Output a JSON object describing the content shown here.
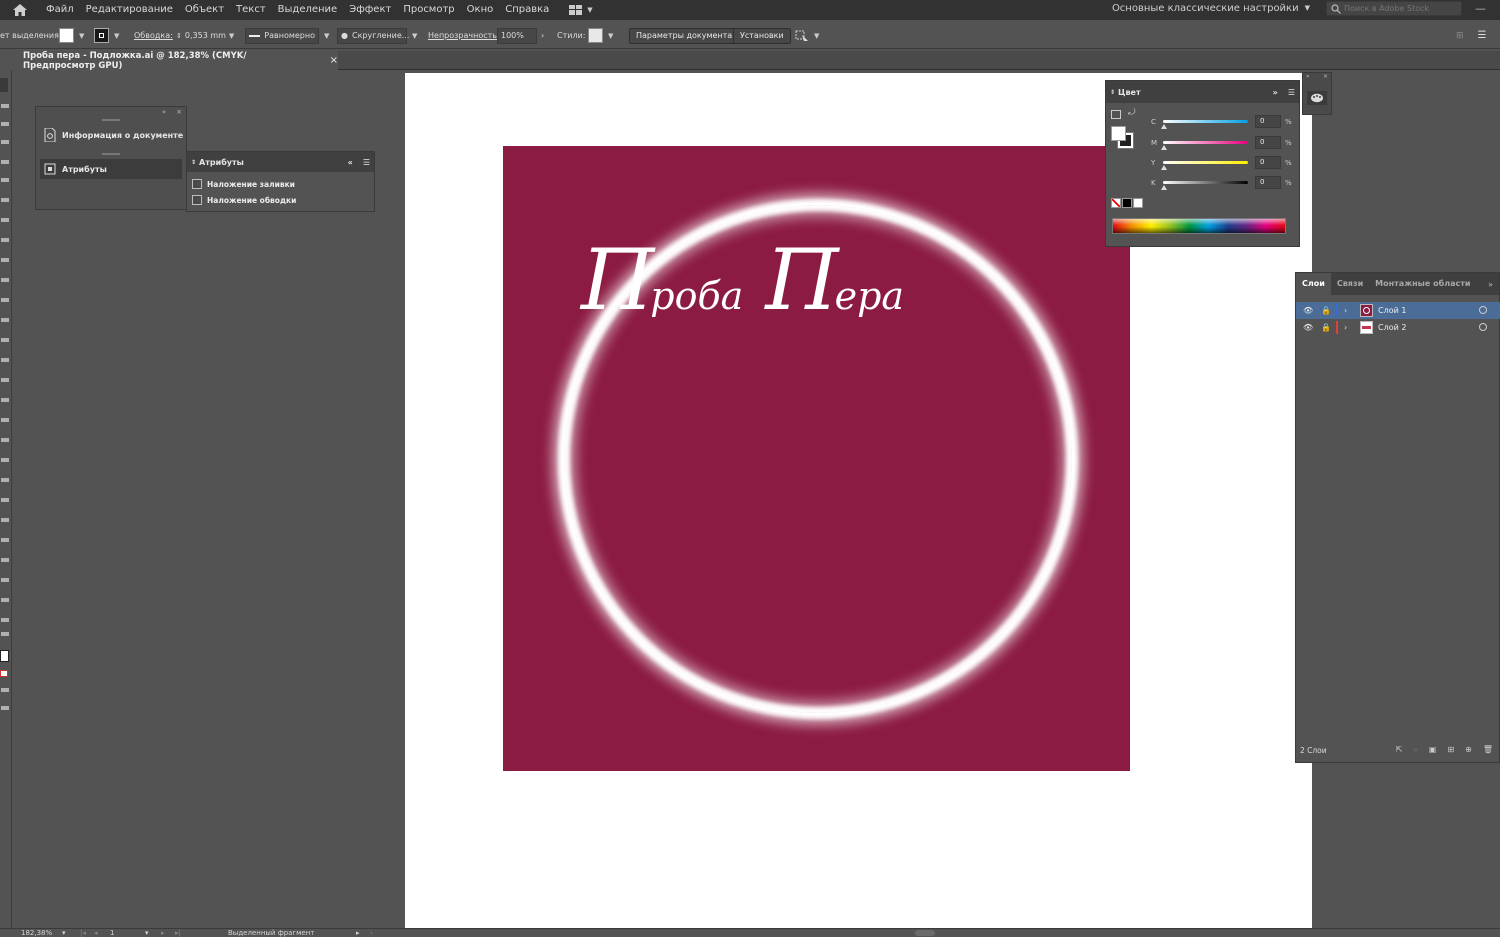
{
  "menu": {
    "items": [
      "Файл",
      "Редактирование",
      "Объект",
      "Текст",
      "Выделение",
      "Эффект",
      "Просмотр",
      "Окно",
      "Справка"
    ],
    "workspace": "Основные классические настройки",
    "search_placeholder": "Поиск в Adobe Stock"
  },
  "controlbar": {
    "selection_label": "ет выделения",
    "stroke_label": "Обводка:",
    "stroke_value": "0,353 mm",
    "profile_value": "Равномерно",
    "brush_value": "Скругление...",
    "opacity_label": "Непрозрачность:",
    "opacity_value": "100%",
    "styles_label": "Стили:",
    "doc_setup_button": "Параметры документа",
    "preferences_button": "Установки"
  },
  "document_tab": {
    "title": "Проба пера - Подложка.ai @ 182,38% (CMYK/Предпросмотр GPU)",
    "close": "×"
  },
  "artwork": {
    "background_color": "#8c1b43",
    "word1_cap": "П",
    "word1_rest": "роба",
    "word2_cap": "П",
    "word2_rest": "ера"
  },
  "docinfo_panel": {
    "items": [
      {
        "label": "Информация о документе"
      },
      {
        "label": "Атрибуты"
      }
    ]
  },
  "attributes_panel": {
    "title": "Атрибуты",
    "overprint_fill": "Наложение заливки",
    "overprint_stroke": "Наложение обводки"
  },
  "color_panel": {
    "title": "Цвет",
    "channels": [
      {
        "name": "C",
        "value": "0",
        "unit": "%",
        "gradient": "linear-gradient(90deg,#fff,#00a0e3)"
      },
      {
        "name": "M",
        "value": "0",
        "unit": "%",
        "gradient": "linear-gradient(90deg,#fff,#e5007e)"
      },
      {
        "name": "Y",
        "value": "0",
        "unit": "%",
        "gradient": "linear-gradient(90deg,#fff,#ffed00)"
      },
      {
        "name": "K",
        "value": "0",
        "unit": "%",
        "gradient": "linear-gradient(90deg,#fff,#000)"
      }
    ]
  },
  "layers_panel": {
    "tabs": [
      "Слои",
      "Связи",
      "Монтажные области"
    ],
    "layers": [
      {
        "name": "Слой 1",
        "color": "#3a6bd6"
      },
      {
        "name": "Слой 2",
        "color": "#e0403a"
      }
    ],
    "count_label": "2 Слои"
  },
  "statusbar": {
    "zoom": "182,38%",
    "artboard_num": "1",
    "tool_status": "Выделенный фрагмент"
  }
}
